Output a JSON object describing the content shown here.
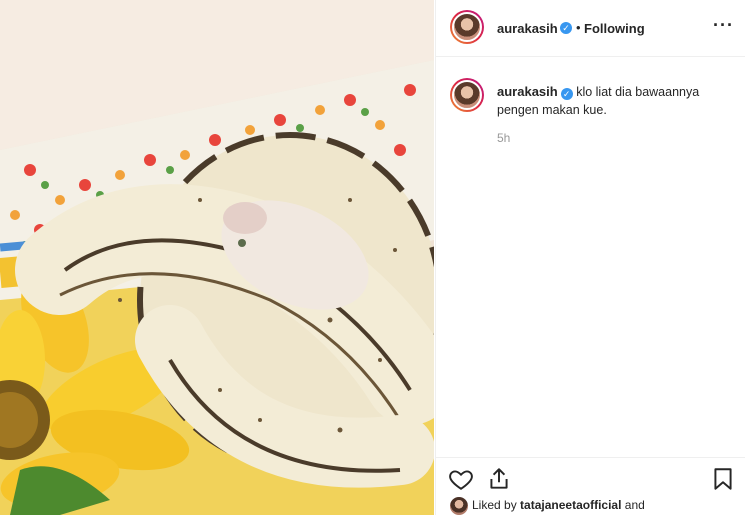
{
  "post": {
    "author": "aurakasih",
    "follow_status": "Following",
    "separator": "•",
    "more_icon": "more-options-icon",
    "caption_text": "klo liat dia bawaannya pengen makan kue.",
    "timestamp": "5h"
  },
  "likes": {
    "prefix": "Liked by",
    "user": "tatajaneetaofficial",
    "suffix": "and"
  },
  "icons": {
    "like": "heart-icon",
    "share": "share-icon",
    "save": "bookmark-icon",
    "verified": "verified-badge-icon"
  },
  "colors": {
    "verified_blue": "#3897f0",
    "muted_text": "#999999",
    "border": "#efefef"
  }
}
